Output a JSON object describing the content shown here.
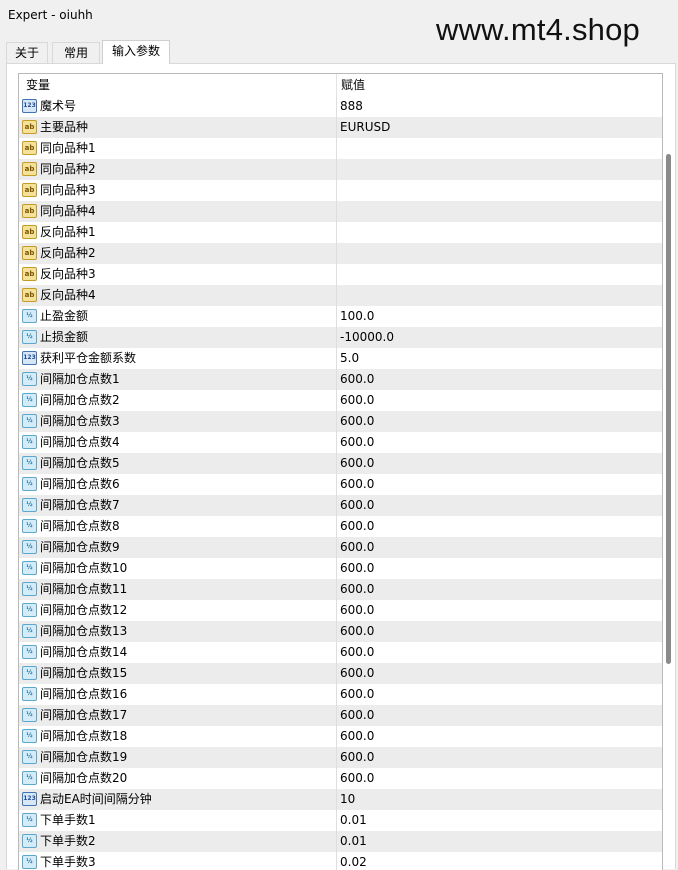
{
  "window": {
    "title": "Expert - oiuhh"
  },
  "watermark": "www.mt4.shop",
  "tabs": [
    {
      "label": "关于",
      "active": false
    },
    {
      "label": "常用",
      "active": false
    },
    {
      "label": "输入参数",
      "active": true
    }
  ],
  "table": {
    "headers": {
      "variable": "变量",
      "value": "赋值"
    },
    "rows": [
      {
        "icon": "int-type-icon",
        "badge": "123",
        "name": "魔术号",
        "value": "888"
      },
      {
        "icon": "string-type-icon",
        "badge": "ab",
        "name": "主要品种",
        "value": "EURUSD"
      },
      {
        "icon": "string-type-icon",
        "badge": "ab",
        "name": "同向品种1",
        "value": ""
      },
      {
        "icon": "string-type-icon",
        "badge": "ab",
        "name": "同向品种2",
        "value": ""
      },
      {
        "icon": "string-type-icon",
        "badge": "ab",
        "name": "同向品种3",
        "value": ""
      },
      {
        "icon": "string-type-icon",
        "badge": "ab",
        "name": "同向品种4",
        "value": ""
      },
      {
        "icon": "string-type-icon",
        "badge": "ab",
        "name": "反向品种1",
        "value": ""
      },
      {
        "icon": "string-type-icon",
        "badge": "ab",
        "name": "反向品种2",
        "value": ""
      },
      {
        "icon": "string-type-icon",
        "badge": "ab",
        "name": "反向品种3",
        "value": ""
      },
      {
        "icon": "string-type-icon",
        "badge": "ab",
        "name": "反向品种4",
        "value": ""
      },
      {
        "icon": "double-type-icon",
        "badge": "½",
        "name": "止盈金额",
        "value": "100.0"
      },
      {
        "icon": "double-type-icon",
        "badge": "½",
        "name": "止损金额",
        "value": "-10000.0"
      },
      {
        "icon": "int-type-icon",
        "badge": "123",
        "name": "获利平仓金额系数",
        "value": "5.0"
      },
      {
        "icon": "double-type-icon",
        "badge": "½",
        "name": "间隔加仓点数1",
        "value": "600.0"
      },
      {
        "icon": "double-type-icon",
        "badge": "½",
        "name": "间隔加仓点数2",
        "value": "600.0"
      },
      {
        "icon": "double-type-icon",
        "badge": "½",
        "name": "间隔加仓点数3",
        "value": "600.0"
      },
      {
        "icon": "double-type-icon",
        "badge": "½",
        "name": "间隔加仓点数4",
        "value": "600.0"
      },
      {
        "icon": "double-type-icon",
        "badge": "½",
        "name": "间隔加仓点数5",
        "value": "600.0"
      },
      {
        "icon": "double-type-icon",
        "badge": "½",
        "name": "间隔加仓点数6",
        "value": "600.0"
      },
      {
        "icon": "double-type-icon",
        "badge": "½",
        "name": "间隔加仓点数7",
        "value": "600.0"
      },
      {
        "icon": "double-type-icon",
        "badge": "½",
        "name": "间隔加仓点数8",
        "value": "600.0"
      },
      {
        "icon": "double-type-icon",
        "badge": "½",
        "name": "间隔加仓点数9",
        "value": "600.0"
      },
      {
        "icon": "double-type-icon",
        "badge": "½",
        "name": "间隔加仓点数10",
        "value": "600.0"
      },
      {
        "icon": "double-type-icon",
        "badge": "½",
        "name": "间隔加仓点数11",
        "value": "600.0"
      },
      {
        "icon": "double-type-icon",
        "badge": "½",
        "name": "间隔加仓点数12",
        "value": "600.0"
      },
      {
        "icon": "double-type-icon",
        "badge": "½",
        "name": "间隔加仓点数13",
        "value": "600.0"
      },
      {
        "icon": "double-type-icon",
        "badge": "½",
        "name": "间隔加仓点数14",
        "value": "600.0"
      },
      {
        "icon": "double-type-icon",
        "badge": "½",
        "name": "间隔加仓点数15",
        "value": "600.0"
      },
      {
        "icon": "double-type-icon",
        "badge": "½",
        "name": "间隔加仓点数16",
        "value": "600.0"
      },
      {
        "icon": "double-type-icon",
        "badge": "½",
        "name": "间隔加仓点数17",
        "value": "600.0"
      },
      {
        "icon": "double-type-icon",
        "badge": "½",
        "name": "间隔加仓点数18",
        "value": "600.0"
      },
      {
        "icon": "double-type-icon",
        "badge": "½",
        "name": "间隔加仓点数19",
        "value": "600.0"
      },
      {
        "icon": "double-type-icon",
        "badge": "½",
        "name": "间隔加仓点数20",
        "value": "600.0"
      },
      {
        "icon": "int-type-icon",
        "badge": "123",
        "name": "启动EA时间间隔分钟",
        "value": "10"
      },
      {
        "icon": "double-type-icon",
        "badge": "½",
        "name": "下单手数1",
        "value": "0.01"
      },
      {
        "icon": "double-type-icon",
        "badge": "½",
        "name": "下单手数2",
        "value": "0.01"
      },
      {
        "icon": "double-type-icon",
        "badge": "½",
        "name": "下单手数3",
        "value": "0.02"
      }
    ]
  }
}
